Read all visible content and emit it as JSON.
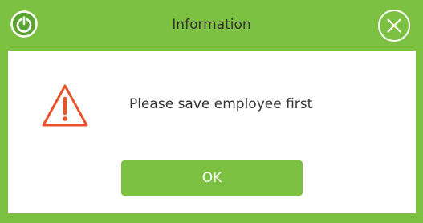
{
  "window": {
    "title": "Information",
    "app_icon": "power-icon",
    "close_icon": "close-circle-icon"
  },
  "dialog": {
    "icon": "warning-icon",
    "message": "Please save employee first",
    "ok_label": "OK"
  },
  "colors": {
    "accent": "#7dc142",
    "warning": "#e8532b",
    "text": "#333333"
  }
}
